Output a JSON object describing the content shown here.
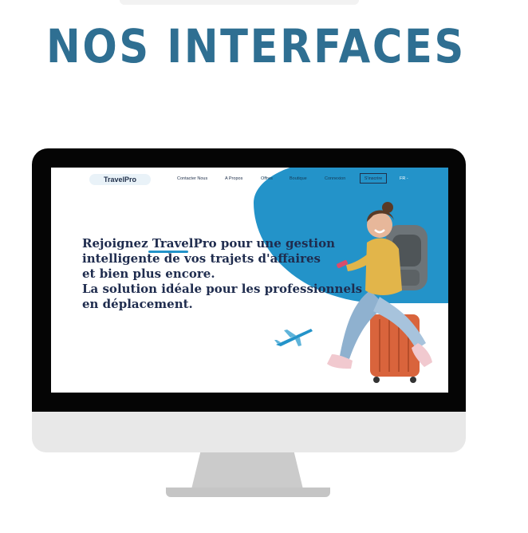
{
  "heading": "NOS INTERFACES",
  "site": {
    "logo": "TravelPro",
    "nav": {
      "contact": "Contacter Nous",
      "about": "A Propos",
      "offers": "Offres",
      "shop": "Boutique",
      "login": "Connexion",
      "signup": "S'inscrire",
      "lang": "FR -"
    },
    "hero": {
      "line1": "Rejoignez TravelPro pour une gestion",
      "line2": "intelligente  de vos trajets d'affaires",
      "line3": " et bien plus encore.",
      "line4": "La solution idéale pour les professionnels",
      "line5": "en déplacement."
    }
  },
  "colors": {
    "heading": "#2f6f92",
    "accent": "#2393c9",
    "text": "#1f2c4e"
  },
  "icons": {
    "plane": "airplane-icon"
  }
}
